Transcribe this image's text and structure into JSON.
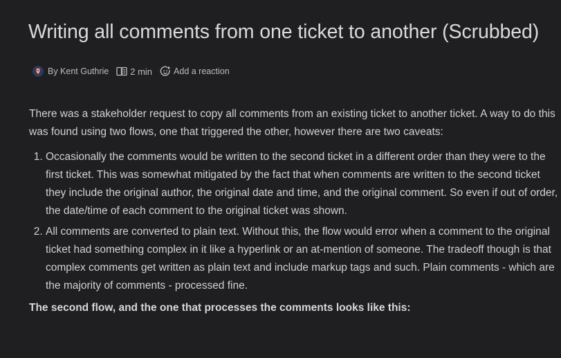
{
  "page": {
    "title": "Writing all comments from one ticket to another (Scrubbed)"
  },
  "meta": {
    "author": "By Kent Guthrie",
    "read_time": "2 min",
    "reaction_label": "Add a reaction",
    "icons": {
      "avatar": "author-avatar",
      "read": "book-icon",
      "reaction": "smiley-add-icon"
    }
  },
  "content": {
    "intro": "There was a stakeholder request to copy all comments from an existing ticket to another ticket. A way to do this was found using two flows, one that triggered the other, however there are two caveats:",
    "items": [
      "Occasionally the comments would be written to the second ticket in a different order than they were to the first ticket. This was somewhat mitigated by the fact that when comments are written to the second ticket they include the original author, the original date and time, and the original comment. So even if out of order, the date/time of each comment to the original ticket was shown.",
      "All comments are converted to plain text. Without this, the flow would error when a comment to the original ticket had something complex in it like a hyperlink or an at-mention of someone. The tradeoff though is that complex comments get written as plain text and include markup tags and such. Plain comments - which are the majority of comments - processed fine."
    ],
    "bold_line": "The second flow, and the one that processes the comments looks like this:"
  }
}
